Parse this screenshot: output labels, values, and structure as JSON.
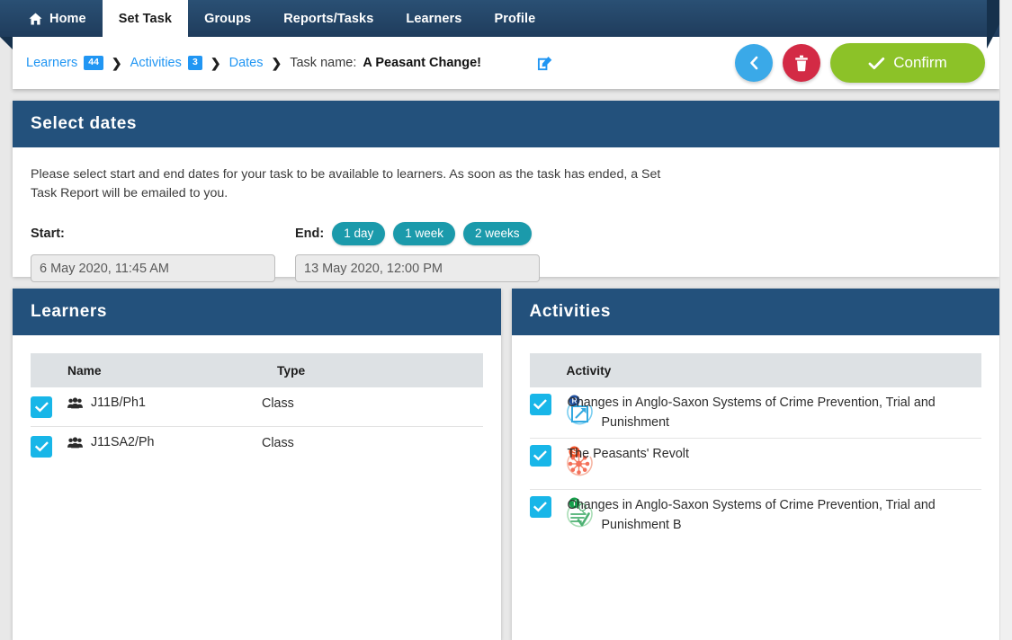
{
  "nav": {
    "tabs": [
      {
        "label": "Home",
        "icon": "home-icon",
        "active": false
      },
      {
        "label": "Set Task",
        "icon": "",
        "active": true
      },
      {
        "label": "Groups",
        "icon": "",
        "active": false
      },
      {
        "label": "Reports/Tasks",
        "icon": "",
        "active": false
      },
      {
        "label": "Learners",
        "icon": "",
        "active": false
      },
      {
        "label": "Profile",
        "icon": "",
        "active": false
      }
    ]
  },
  "breadcrumb": {
    "learners_label": "Learners",
    "learners_badge": "44",
    "activities_label": "Activities",
    "activities_badge": "3",
    "dates_label": "Dates",
    "taskname_label": "Task name:",
    "taskname_value": "A Peasant Change!",
    "separator": "❯",
    "edit_icon": "edit-pencil-icon"
  },
  "actions": {
    "back_icon": "chevron-left-icon",
    "delete_icon": "trash-icon",
    "confirm_label": "Confirm",
    "confirm_icon": "check-icon"
  },
  "dates": {
    "title": "Select dates",
    "description": "Please select start and end dates for your task to be available to learners. As soon as the task has ended, a Set Task Report will be emailed to you.",
    "start_label": "Start:",
    "start_value": "6 May 2020, 11:45 AM",
    "end_label": "End:",
    "end_value": "13 May 2020, 12:00 PM",
    "quick_pills": [
      "1 day",
      "1 week",
      "2 weeks"
    ]
  },
  "learners": {
    "title": "Learners",
    "columns": [
      "Name",
      "Type"
    ],
    "rows": [
      {
        "checked": true,
        "icon": "group-icon",
        "name": "J11B/Ph1",
        "type": "Class"
      },
      {
        "checked": true,
        "icon": "group-icon",
        "name": "J11SA2/Ph",
        "type": "Class"
      }
    ]
  },
  "activities": {
    "title": "Activities",
    "columns": [
      "Activity"
    ],
    "rows": [
      {
        "checked": true,
        "icon": "resource-link-icon",
        "badge": "R",
        "label": "Changes in Anglo-Saxon Systems of Crime Prevention, Trial and Punishment"
      },
      {
        "checked": true,
        "icon": "spider-diagram-icon",
        "badge": "S",
        "label": "The Peasants' Revolt"
      },
      {
        "checked": true,
        "icon": "quiz-icon",
        "badge": "T",
        "label": "Changes in Anglo-Saxon Systems of Crime Prevention, Trial and Punishment B"
      }
    ]
  },
  "colors": {
    "nav_dark": "#1f3c5c",
    "panel_header": "#23517c",
    "link_blue": "#2196f3",
    "checkbox_cyan": "#18b6e8",
    "confirm_green": "#8cc228",
    "delete_red": "#d32a45",
    "back_blue": "#3aa9e8",
    "pill_teal": "#1b9aab",
    "table_header_grey": "#dde1e4"
  }
}
